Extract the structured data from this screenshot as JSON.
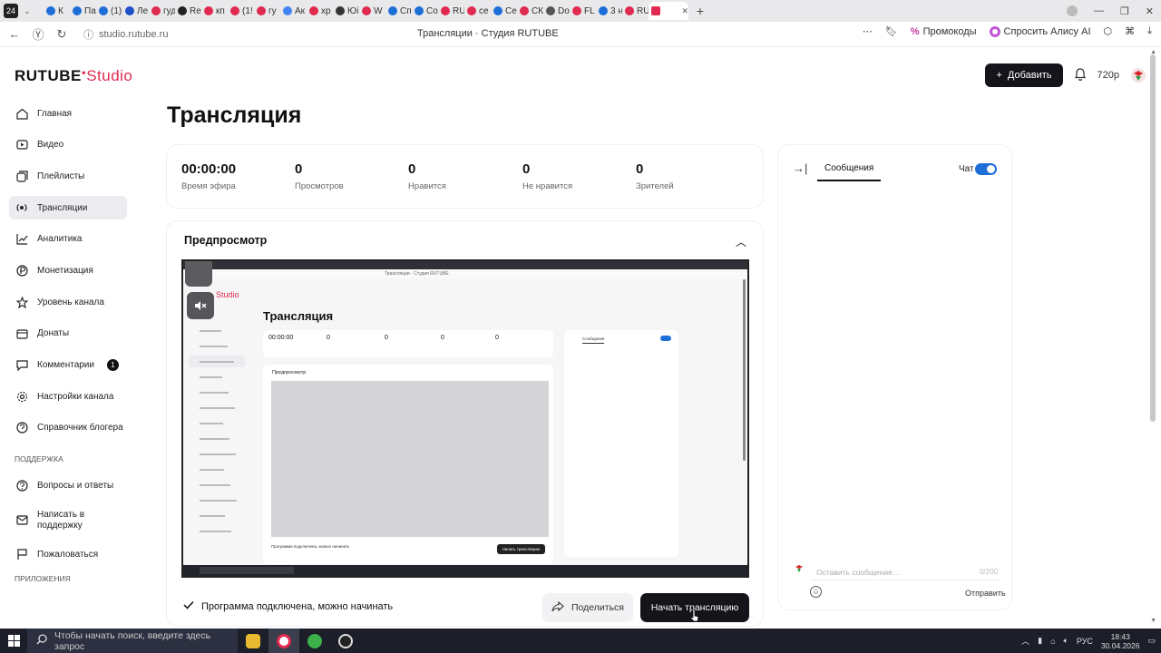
{
  "browser": {
    "profile_badge": "24",
    "tabs": [
      {
        "label": "К",
        "color": "#1e6ed8"
      },
      {
        "label": "Па",
        "color": "#1e6ed8"
      },
      {
        "label": "(1)",
        "color": "#1e6ed8"
      },
      {
        "label": "Ле",
        "color": "#1e50c8"
      },
      {
        "label": "гуд",
        "color": "#e02a4f"
      },
      {
        "label": "Re",
        "color": "#222222"
      },
      {
        "label": "кп",
        "color": "#e02a4f"
      },
      {
        "label": "(1!",
        "color": "#e02a4f"
      },
      {
        "label": "гу",
        "color": "#e02a4f"
      },
      {
        "label": "Ак",
        "color": "#4285f4"
      },
      {
        "label": "хр",
        "color": "#e02a4f"
      },
      {
        "label": "Юі",
        "color": "#333333"
      },
      {
        "label": "W",
        "color": "#e02a4f"
      },
      {
        "label": "Сп",
        "color": "#1e6ed8"
      },
      {
        "label": "Со",
        "color": "#1e6ed8"
      },
      {
        "label": "RU",
        "color": "#e02a4f"
      },
      {
        "label": "се",
        "color": "#e02a4f"
      },
      {
        "label": "Се",
        "color": "#1e6ed8"
      },
      {
        "label": "СК",
        "color": "#e02a4f"
      },
      {
        "label": "Do",
        "color": "#555555"
      },
      {
        "label": "FL",
        "color": "#e02a4f"
      },
      {
        "label": "3 н",
        "color": "#1e6ed8"
      },
      {
        "label": "RU",
        "color": "#e02a4f"
      }
    ],
    "url": "studio.rutube.ru",
    "page_title": "Трансляции · Студия RUTUBE",
    "promo_label": "Промокоды",
    "alice_label": "Спросить Алису AI"
  },
  "header": {
    "logo_main": "RUTUBE",
    "logo_studio": "Studio",
    "add_label": "Добавить",
    "quality": "720p"
  },
  "sidebar": {
    "items": [
      {
        "label": "Главная",
        "icon": "home-icon"
      },
      {
        "label": "Видео",
        "icon": "video-icon"
      },
      {
        "label": "Плейлисты",
        "icon": "playlist-icon"
      },
      {
        "label": "Трансляции",
        "icon": "broadcast-icon"
      },
      {
        "label": "Аналитика",
        "icon": "analytics-icon"
      },
      {
        "label": "Монетизация",
        "icon": "money-icon"
      },
      {
        "label": "Уровень канала",
        "icon": "star-icon"
      },
      {
        "label": "Донаты",
        "icon": "donate-icon"
      },
      {
        "label": "Комментарии",
        "icon": "comment-icon",
        "badge": "1"
      },
      {
        "label": "Настройки канала",
        "icon": "gear-icon"
      },
      {
        "label": "Справочник блогера",
        "icon": "help-icon"
      }
    ],
    "support_heading": "ПОДДЕРЖКА",
    "support_items": [
      {
        "label": "Вопросы и ответы",
        "icon": "question-icon"
      },
      {
        "label": "Написать в поддержку",
        "icon": "mail-icon"
      },
      {
        "label": "Пожаловаться",
        "icon": "flag-icon"
      }
    ],
    "apps_heading": "ПРИЛОЖЕНИЯ"
  },
  "main": {
    "title": "Трансляция",
    "stats": [
      {
        "value": "00:00:00",
        "label": "Время эфира"
      },
      {
        "value": "0",
        "label": "Просмотров"
      },
      {
        "value": "0",
        "label": "Нравится"
      },
      {
        "value": "0",
        "label": "Не нравится"
      },
      {
        "value": "0",
        "label": "Зрителей"
      }
    ],
    "preview": {
      "title": "Предпросмотр",
      "status": "Программа подключена, можно начинать",
      "share_label": "Поделиться",
      "start_label": "Начать трансляцию"
    }
  },
  "nested": {
    "logo": "Studio",
    "page_title": "Трансляции · Студия RUTUBE",
    "title": "Трансляция",
    "stats": [
      "00:00:00",
      "0",
      "0",
      "0",
      "0"
    ],
    "preview_label": "Предпросмотр",
    "status": "Программа подключена, можно начинать",
    "start": "Начать трансляцию",
    "chat_tab": "Сообщения"
  },
  "chat": {
    "tab_label": "Сообщения",
    "toggle_label": "Чат",
    "toggle_on": true,
    "input_placeholder": "Оставить сообщение…",
    "counter": "0/200",
    "send_label": "Отправить"
  },
  "taskbar": {
    "search_placeholder": "Чтобы начать поиск, введите здесь запрос",
    "language": "РУС",
    "time": "18:43",
    "date": "30.04.2026"
  }
}
